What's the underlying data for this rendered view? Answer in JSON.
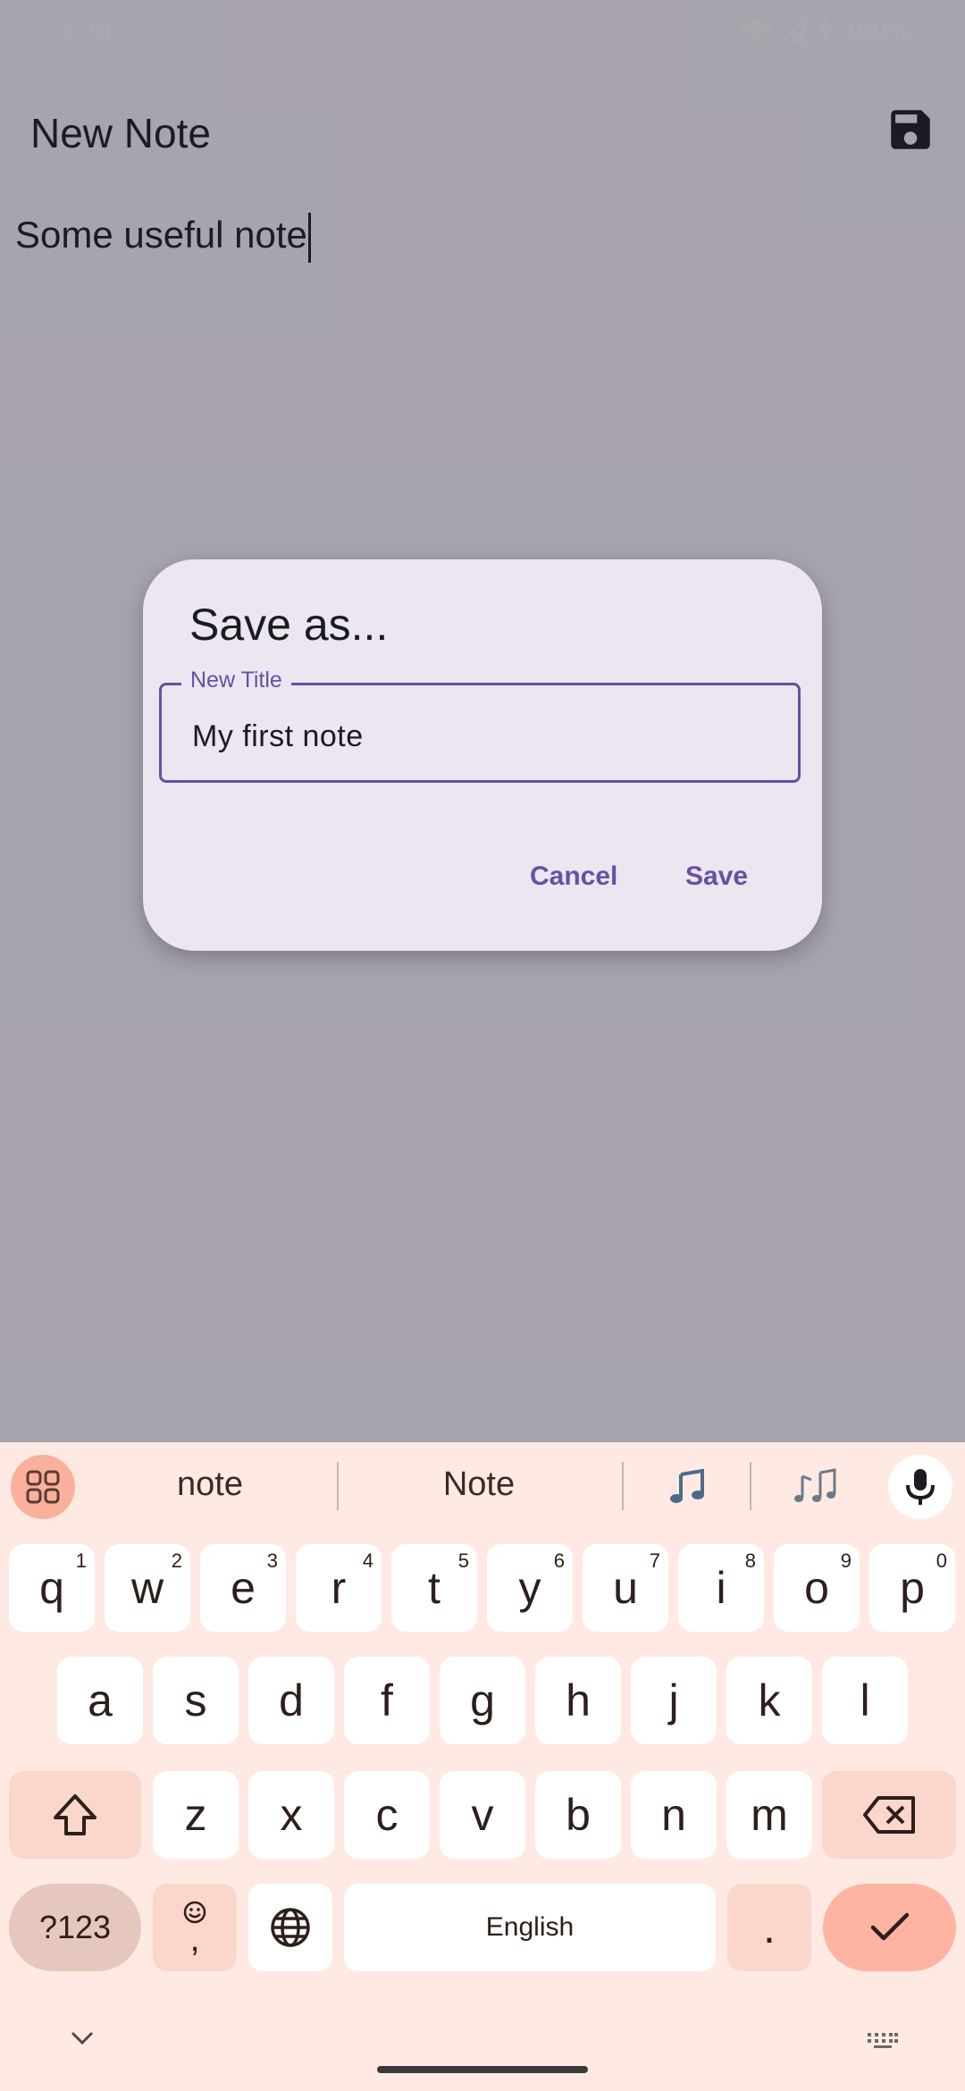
{
  "status_bar": {
    "time": "2:20",
    "battery": "100%"
  },
  "app": {
    "title": "New Note",
    "note_text": "Some useful note"
  },
  "dialog": {
    "title": "Save as...",
    "field_label": "New Title",
    "field_value": "My first note",
    "cancel_label": "Cancel",
    "save_label": "Save"
  },
  "keyboard": {
    "suggestions": [
      "note",
      "Note"
    ],
    "row1": [
      {
        "k": "q",
        "h": "1"
      },
      {
        "k": "w",
        "h": "2"
      },
      {
        "k": "e",
        "h": "3"
      },
      {
        "k": "r",
        "h": "4"
      },
      {
        "k": "t",
        "h": "5"
      },
      {
        "k": "y",
        "h": "6"
      },
      {
        "k": "u",
        "h": "7"
      },
      {
        "k": "i",
        "h": "8"
      },
      {
        "k": "o",
        "h": "9"
      },
      {
        "k": "p",
        "h": "0"
      }
    ],
    "row2": [
      "a",
      "s",
      "d",
      "f",
      "g",
      "h",
      "j",
      "k",
      "l"
    ],
    "row3": [
      "z",
      "x",
      "c",
      "v",
      "b",
      "n",
      "m"
    ],
    "symbols_label": "?123",
    "emoji_comma_label": ",",
    "space_label": "English",
    "period_label": "."
  },
  "colors": {
    "accent": "#6750a4",
    "keyboard_bg": "#ffeae3",
    "enter_key": "#ffb4a1"
  }
}
